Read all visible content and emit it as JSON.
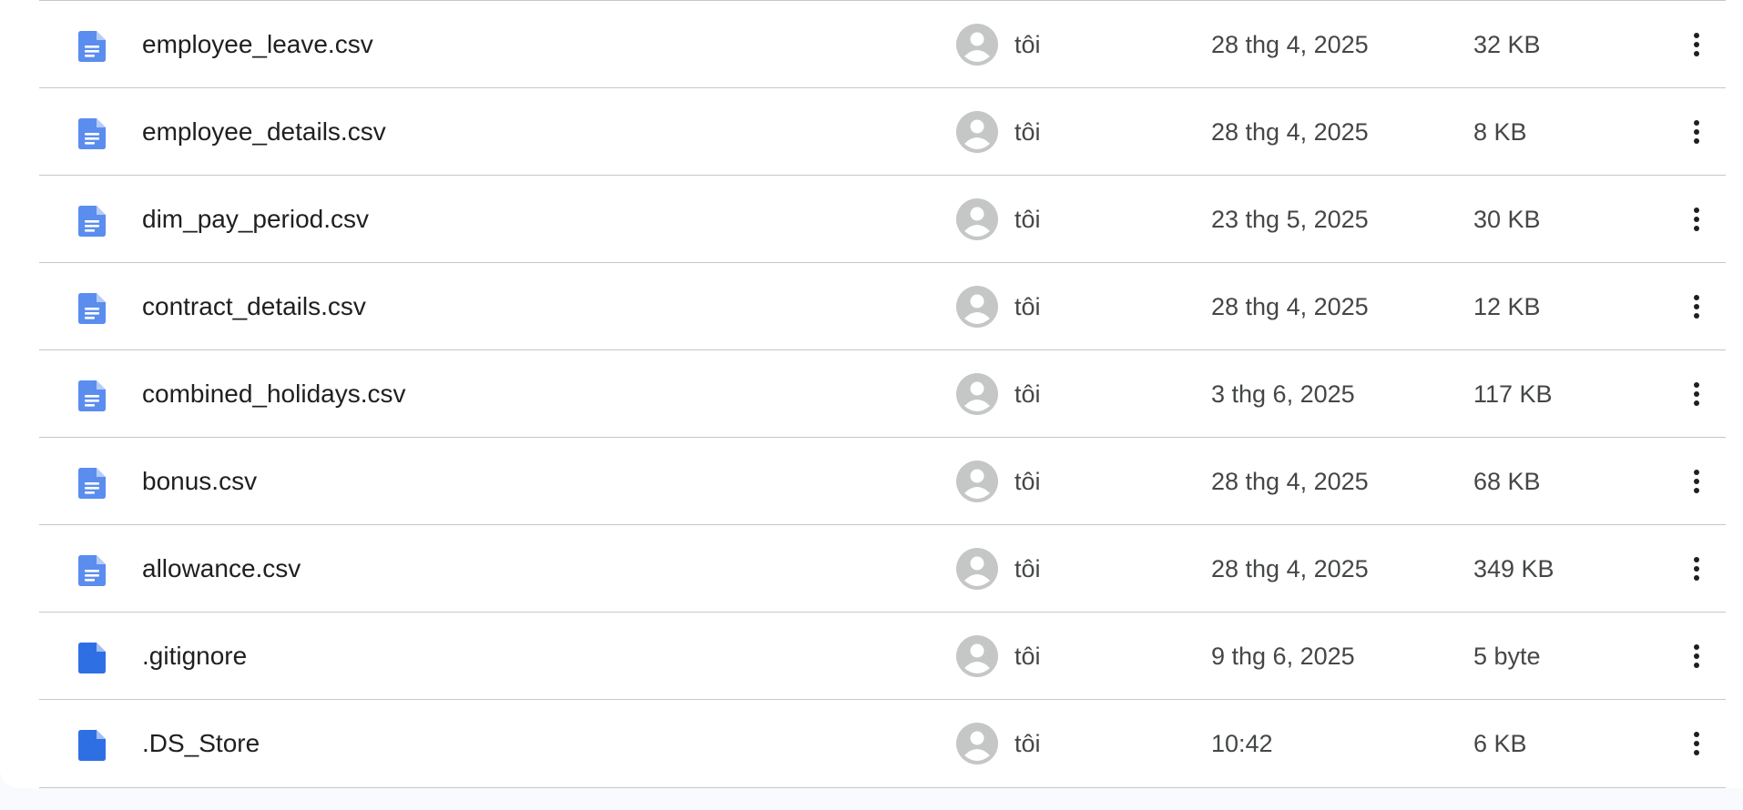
{
  "colors": {
    "doc_icon": "#5b8def",
    "file_icon": "#2f6fe4",
    "avatar": "#c4c7c5",
    "text_primary": "#1f1f1f",
    "text_secondary": "#444746",
    "divider": "#c7c7c7"
  },
  "files": [
    {
      "name": "employee_leave.csv",
      "icon": "document-icon",
      "owner": "tôi",
      "modified": "28 thg 4, 2025",
      "size": "32 KB"
    },
    {
      "name": "employee_details.csv",
      "icon": "document-icon",
      "owner": "tôi",
      "modified": "28 thg 4, 2025",
      "size": "8 KB"
    },
    {
      "name": "dim_pay_period.csv",
      "icon": "document-icon",
      "owner": "tôi",
      "modified": "23 thg 5, 2025",
      "size": "30 KB"
    },
    {
      "name": "contract_details.csv",
      "icon": "document-icon",
      "owner": "tôi",
      "modified": "28 thg 4, 2025",
      "size": "12 KB"
    },
    {
      "name": "combined_holidays.csv",
      "icon": "document-icon",
      "owner": "tôi",
      "modified": "3 thg 6, 2025",
      "size": "117 KB"
    },
    {
      "name": "bonus.csv",
      "icon": "document-icon",
      "owner": "tôi",
      "modified": "28 thg 4, 2025",
      "size": "68 KB"
    },
    {
      "name": "allowance.csv",
      "icon": "document-icon",
      "owner": "tôi",
      "modified": "28 thg 4, 2025",
      "size": "349 KB"
    },
    {
      "name": ".gitignore",
      "icon": "file-icon",
      "owner": "tôi",
      "modified": "9 thg 6, 2025",
      "size": "5 byte"
    },
    {
      "name": ".DS_Store",
      "icon": "file-icon",
      "owner": "tôi",
      "modified": "10:42",
      "size": "6 KB"
    }
  ]
}
